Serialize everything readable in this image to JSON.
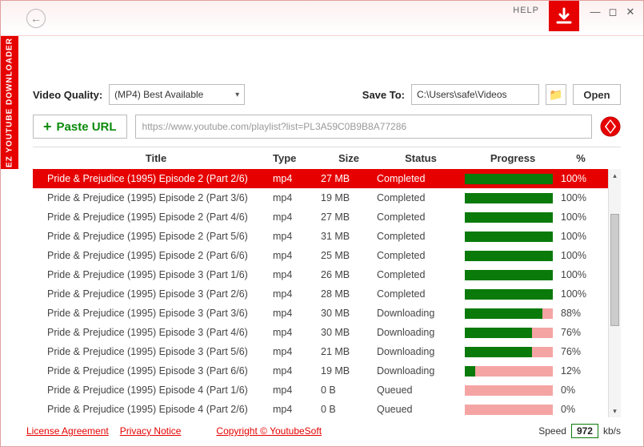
{
  "app": {
    "sidebar_label": "EZ YOUTUBE DOWNLOADER FREE",
    "help": "HELP"
  },
  "controls": {
    "quality_label": "Video Quality:",
    "quality_value": "(MP4) Best Available",
    "save_label": "Save To:",
    "save_path": "C:\\Users\\safe\\Videos",
    "open": "Open",
    "paste": "Paste URL",
    "url_placeholder": "https://www.youtube.com/playlist?list=PL3A59C0B9B8A77286"
  },
  "columns": {
    "title": "Title",
    "type": "Type",
    "size": "Size",
    "status": "Status",
    "progress": "Progress",
    "pct": "%"
  },
  "rows": [
    {
      "title": "Pride & Prejudice (1995) Episode 2 (Part 2/6)",
      "type": "mp4",
      "size": "27 MB",
      "status": "Completed",
      "progress": 100,
      "pct": "100%",
      "selected": true
    },
    {
      "title": "Pride & Prejudice (1995) Episode 2 (Part 3/6)",
      "type": "mp4",
      "size": "19 MB",
      "status": "Completed",
      "progress": 100,
      "pct": "100%"
    },
    {
      "title": "Pride & Prejudice (1995) Episode 2 (Part 4/6)",
      "type": "mp4",
      "size": "27 MB",
      "status": "Completed",
      "progress": 100,
      "pct": "100%"
    },
    {
      "title": "Pride & Prejudice (1995) Episode 2 (Part 5/6)",
      "type": "mp4",
      "size": "31 MB",
      "status": "Completed",
      "progress": 100,
      "pct": "100%"
    },
    {
      "title": "Pride & Prejudice (1995) Episode 2 (Part 6/6)",
      "type": "mp4",
      "size": "25 MB",
      "status": "Completed",
      "progress": 100,
      "pct": "100%"
    },
    {
      "title": "Pride & Prejudice (1995) Episode 3 (Part 1/6)",
      "type": "mp4",
      "size": "26 MB",
      "status": "Completed",
      "progress": 100,
      "pct": "100%"
    },
    {
      "title": "Pride & Prejudice (1995) Episode 3 (Part 2/6)",
      "type": "mp4",
      "size": "28 MB",
      "status": "Completed",
      "progress": 100,
      "pct": "100%"
    },
    {
      "title": "Pride & Prejudice (1995) Episode 3 (Part 3/6)",
      "type": "mp4",
      "size": "30 MB",
      "status": "Downloading",
      "progress": 88,
      "pct": "88%"
    },
    {
      "title": "Pride & Prejudice (1995) Episode 3 (Part 4/6)",
      "type": "mp4",
      "size": "30 MB",
      "status": "Downloading",
      "progress": 76,
      "pct": "76%"
    },
    {
      "title": "Pride & Prejudice (1995) Episode 3 (Part 5/6)",
      "type": "mp4",
      "size": "21 MB",
      "status": "Downloading",
      "progress": 76,
      "pct": "76%"
    },
    {
      "title": "Pride & Prejudice (1995) Episode 3 (Part 6/6)",
      "type": "mp4",
      "size": "19 MB",
      "status": "Downloading",
      "progress": 12,
      "pct": "12%"
    },
    {
      "title": "Pride & Prejudice (1995) Episode 4 (Part 1/6)",
      "type": "mp4",
      "size": "0 B",
      "status": "Queued",
      "progress": 0,
      "pct": "0%"
    },
    {
      "title": "Pride & Prejudice (1995) Episode 4 (Part 2/6)",
      "type": "mp4",
      "size": "0 B",
      "status": "Queued",
      "progress": 0,
      "pct": "0%"
    }
  ],
  "footer": {
    "license": "License Agreement",
    "privacy": "Privacy Notice",
    "copyright": "Copyright © YoutubeSoft",
    "speed_label": "Speed",
    "speed_value": "972",
    "speed_unit": "kb/s"
  }
}
